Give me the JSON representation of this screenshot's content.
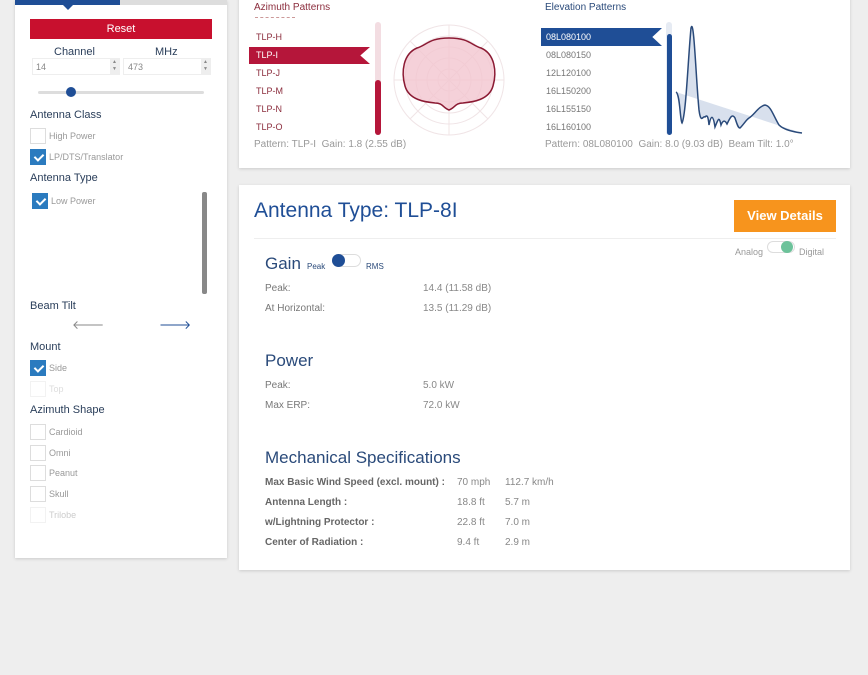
{
  "sidebar": {
    "reset": "Reset",
    "channel_label": "Channel",
    "mhz_label": "MHz",
    "channel_value": "14",
    "mhz_value": "473",
    "slider_fraction": 0.2,
    "antenna_class": {
      "title": "Antenna Class",
      "items": [
        {
          "label": "High Power",
          "checked": false
        },
        {
          "label": "LP/DTS/Translator",
          "checked": true
        }
      ]
    },
    "antenna_type": {
      "title": "Antenna Type",
      "items": [
        {
          "label": "Low Power",
          "checked": true
        }
      ]
    },
    "beam_tilt": {
      "title": "Beam Tilt"
    },
    "mount": {
      "title": "Mount",
      "items": [
        {
          "label": "Side",
          "checked": true
        },
        {
          "label": "Top",
          "checked": false
        }
      ]
    },
    "azimuth_shape": {
      "title": "Azimuth Shape",
      "items": [
        {
          "label": "Cardioid"
        },
        {
          "label": "Omni"
        },
        {
          "label": "Peanut"
        },
        {
          "label": "Skull"
        },
        {
          "label": "Trilobe"
        }
      ]
    }
  },
  "patterns": {
    "azimuth": {
      "title": "Azimuth Patterns",
      "items": [
        "TLP-H",
        "TLP-I",
        "TLP-J",
        "TLP-M",
        "TLP-N",
        "TLP-O"
      ],
      "selected": "TLP-I",
      "footer_pattern_label": "Pattern:",
      "footer_pattern": "TLP-I",
      "footer_gain_label": "Gain:",
      "footer_gain": "1.8 (2.55 dB)"
    },
    "elevation": {
      "title": "Elevation Patterns",
      "items": [
        "08L080100",
        "08L080150",
        "12L120100",
        "16L150200",
        "16L155150",
        "16L160100"
      ],
      "selected": "08L080100",
      "footer_pattern_label": "Pattern:",
      "footer_pattern": "08L080100",
      "footer_gain_label": "Gain:",
      "footer_gain": "8.0 (9.03 dB)",
      "footer_tilt_label": "Beam Tilt:",
      "footer_tilt": "1.0°"
    }
  },
  "details": {
    "title": "Antenna Type: TLP-8I",
    "view_details": "View Details",
    "analog": "Analog",
    "digital": "Digital",
    "gain": {
      "title": "Gain",
      "peak_toggle": "Peak",
      "rms_toggle": "RMS",
      "rows": [
        {
          "label": "Peak:",
          "value": "14.4 (11.58 dB)"
        },
        {
          "label": "At Horizontal:",
          "value": "13.5 (11.29 dB)"
        }
      ]
    },
    "power": {
      "title": "Power",
      "rows": [
        {
          "label": "Peak:",
          "value": "5.0 kW"
        },
        {
          "label": "Max ERP:",
          "value": "72.0 kW"
        }
      ]
    },
    "mech": {
      "title": "Mechanical Specifications",
      "rows": [
        {
          "label": "Max Basic Wind Speed (excl. mount) :",
          "v1": "70 mph",
          "v2": "112.7 km/h"
        },
        {
          "label": "Antenna Length :",
          "v1": "18.8 ft",
          "v2": "5.7 m"
        },
        {
          "label": "w/Lightning Protector :",
          "v1": "22.8 ft",
          "v2": "7.0 m"
        },
        {
          "label": "Center of Radiation :",
          "v1": "9.4 ft",
          "v2": "2.9 m"
        }
      ]
    }
  },
  "colors": {
    "red": "#c8102e",
    "blue": "#1f4e96",
    "orange": "#f7941d",
    "green": "#6cc29a"
  }
}
